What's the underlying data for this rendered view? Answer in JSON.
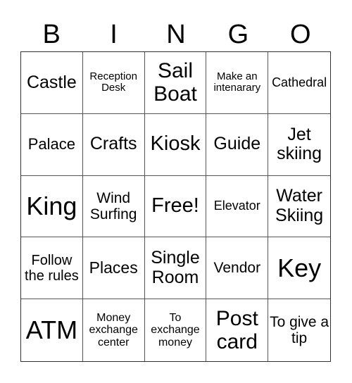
{
  "header": {
    "letters": [
      "B",
      "I",
      "N",
      "G",
      "O"
    ]
  },
  "cells": [
    [
      "Castle",
      "Reception Desk",
      "Sail Boat",
      "Make an intenarary",
      "Cathedral"
    ],
    [
      "Palace",
      "Crafts",
      "Kiosk",
      "Guide",
      "Jet skiing"
    ],
    [
      "King",
      "Wind Surfing",
      "Free!",
      "Elevator",
      "Water Skiing"
    ],
    [
      "Follow the rules",
      "Places",
      "Single Room",
      "Vendor",
      "Key"
    ],
    [
      "ATM",
      "Money exchange center",
      "To exchange money",
      "Post card",
      "To give a tip"
    ]
  ]
}
